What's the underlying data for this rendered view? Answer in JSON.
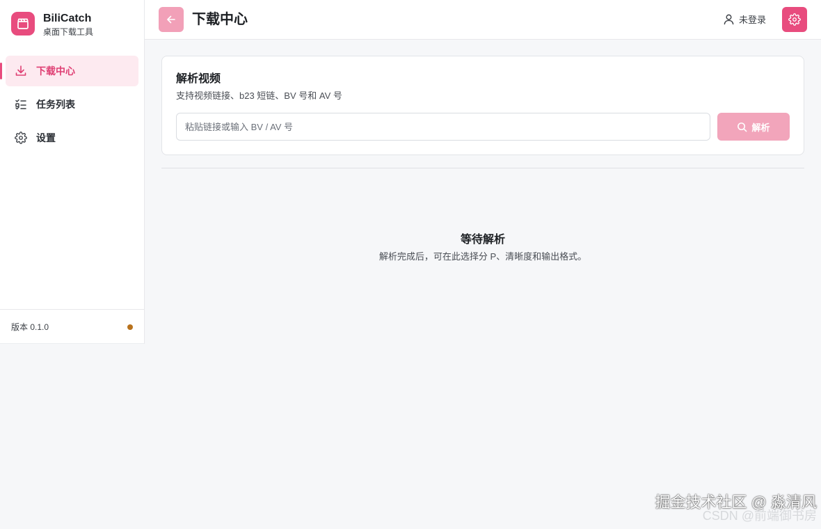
{
  "app": {
    "name": "BiliCatch",
    "subtitle": "桌面下载工具",
    "version": "版本 0.1.0",
    "accent_color": "#e84c7e",
    "status_dot_color": "#b8721d"
  },
  "sidebar": {
    "items": [
      {
        "label": "下载中心",
        "icon": "download-icon",
        "active": true
      },
      {
        "label": "任务列表",
        "icon": "task-list-icon",
        "active": false
      },
      {
        "label": "设置",
        "icon": "gear-icon",
        "active": false
      }
    ]
  },
  "header": {
    "title": "下载中心",
    "user_label": "未登录"
  },
  "parse_card": {
    "title": "解析视频",
    "subtitle": "支持视频链接、b23 短链、BV 号和 AV 号",
    "input_placeholder": "粘贴链接或输入 BV / AV 号",
    "input_value": "",
    "button_label": "解析"
  },
  "empty_state": {
    "title": "等待解析",
    "message": "解析完成后，可在此选择分 P、清晰度和输出格式。"
  },
  "watermark": {
    "line1": "掘金技术社区 @ 淼清风",
    "line2": "CSDN @前端御书房"
  }
}
